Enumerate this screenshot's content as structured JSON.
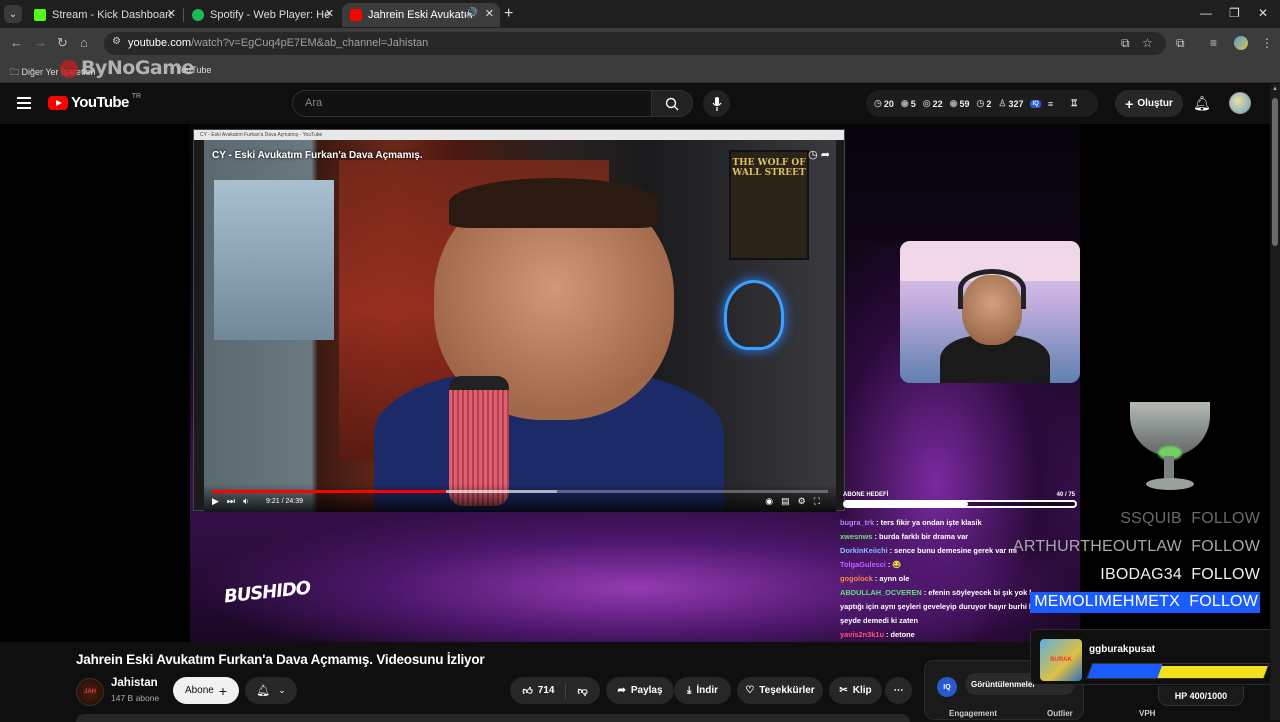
{
  "browser": {
    "tabs": [
      {
        "label": "Stream - Kick Dashboard",
        "favicon_color": "#53fc18",
        "active": false
      },
      {
        "label": "Spotify - Web Player: Herkes için",
        "favicon_color": "#1db954",
        "active": false
      },
      {
        "label": "Jahrein Eski Avukatım Furkan'a",
        "favicon_color": "#ff0000",
        "active": true
      }
    ],
    "url_host": "youtube.com",
    "url_path": "/watch?v=EgCuq4pE7EM&ab_channel=Jahistan",
    "bookmarks_folder": "Diğer Yer İşaretleri",
    "bookmark_youtube": "YouTube",
    "watermark": "ByNoGame"
  },
  "masthead": {
    "logo_text": "YouTube",
    "country_code": "TR",
    "search_placeholder": "Ara",
    "stats": [
      "20",
      "5",
      "22",
      "59",
      "2",
      "327"
    ],
    "create_label": "Oluştur"
  },
  "stream": {
    "inner_window_title": "CY - Eski Avukatım Furkan'a Dava Açmamış - YouTube",
    "inner_video_title": "CY - Eski Avukatım Furkan'a Dava Açmamış.",
    "inner_time": "9:21 / 24:39",
    "inner_progress_fraction": 0.38,
    "poster_text": "THE WOLF OF WALL STREET",
    "overlay_brand": "BUSHIDO",
    "sub_goal_label": "ABONE HEDEFİ",
    "sub_goal_count": "40 / 75",
    "sub_goal_fraction": 0.533,
    "chat": [
      {
        "user": "bugra_trk",
        "text": "ters fikir ya ondan işte klasik",
        "color": "#b080ff"
      },
      {
        "user": "xwesnws",
        "text": "burda farklı bir drama var",
        "color": "#70e070"
      },
      {
        "user": "DorkinKeiichi",
        "text": "sence bunu demesine gerek var mı",
        "color": "#80c0ff"
      },
      {
        "user": "TolgaGulesci",
        "text": "😂",
        "color": "#c060ff"
      },
      {
        "user": "gogolock",
        "text": "aynn ole",
        "color": "#ff8040"
      },
      {
        "user": "ABDULLAH_OCVEREN",
        "text": "efenin söyleyecek bi şık yok l",
        "color": "#60e080"
      },
      {
        "user": "",
        "text": "yaptığı için aynı şeyleri geveleyip duruyor hayır burhi bu",
        "color": "#ffffff"
      },
      {
        "user": "",
        "text": "şeyde demedi ki zaten",
        "color": "#ffffff"
      },
      {
        "user": "yavis2n3k1u",
        "text": "detone",
        "color": "#ff5080"
      }
    ],
    "follows": [
      {
        "name": "SSQUIB",
        "action": "FOLLOW"
      },
      {
        "name": "ARTHURTHEOUTLAW",
        "action": "FOLLOW"
      },
      {
        "name": "IBODAG34",
        "action": "FOLLOW"
      },
      {
        "name": "MEMOLIMEHMETX",
        "action": "FOLLOW"
      }
    ]
  },
  "video": {
    "title": "Jahrein Eski Avukatım Furkan'a Dava Açmamış. Videosunu İzliyor",
    "channel_name": "Jahistan",
    "channel_subs": "147 B abone",
    "subscribe_label": "Abone",
    "likes": "714",
    "share_label": "Paylaş",
    "download_label": "İndir",
    "thanks_label": "Teşekkürler",
    "clip_label": "Klip"
  },
  "analytics": {
    "badge": "IQ",
    "tab_label": "Görüntülenmeler",
    "columns": [
      "Engagement",
      "Outlier",
      "VPH"
    ]
  },
  "alert": {
    "user": "ggburakpusat",
    "hp_label": "HP 400/1000",
    "hp_fraction": 0.4
  }
}
